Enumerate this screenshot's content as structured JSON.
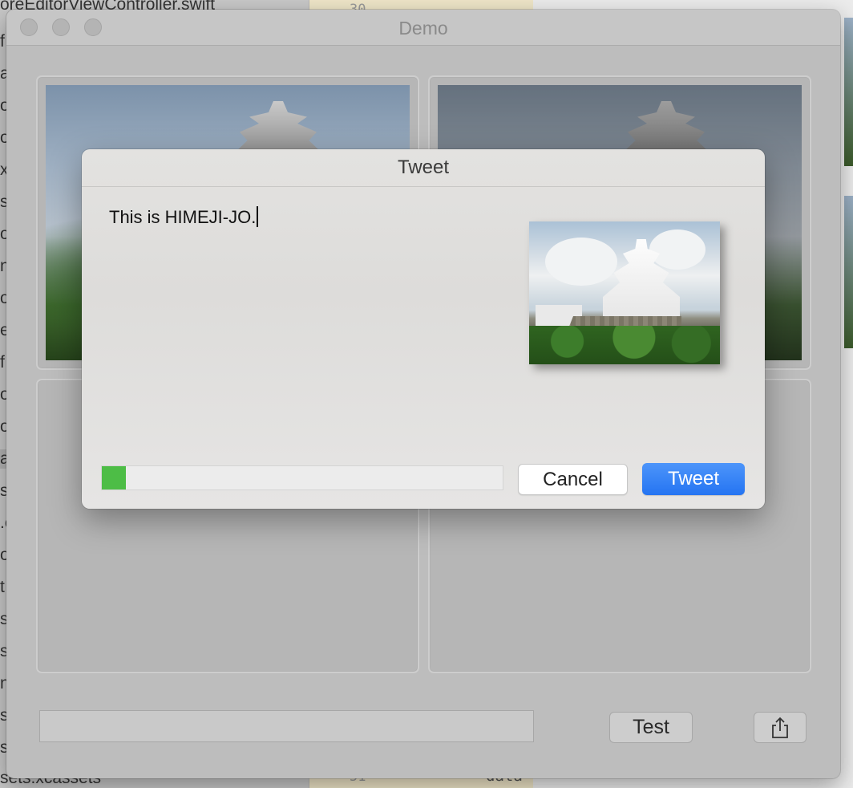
{
  "background": {
    "navigator_rows": [
      "oreEditorViewController.swift",
      "f",
      "a",
      "o",
      "o",
      "x",
      "s",
      "o",
      "n",
      "o",
      "e",
      "f",
      "o",
      "o",
      "a",
      "s",
      ".c",
      "o",
      "t",
      "s",
      "s",
      "ni",
      "s",
      "s",
      "sets.xcassets"
    ],
    "editor_line_top": "30",
    "editor_line_bottom": "51",
    "editor_code_bottom": "data"
  },
  "window": {
    "title": "Demo",
    "test_button": "Test",
    "share_icon": "share-icon",
    "status_field_value": ""
  },
  "sheet": {
    "title": "Tweet",
    "text": "This is HIMEJI-JO.",
    "attachment_icon": "photo-thumbnail",
    "progress_percent": 6,
    "cancel_label": "Cancel",
    "tweet_label": "Tweet",
    "accent_color": "#2f7cf6",
    "progress_color": "#4dbd46"
  }
}
